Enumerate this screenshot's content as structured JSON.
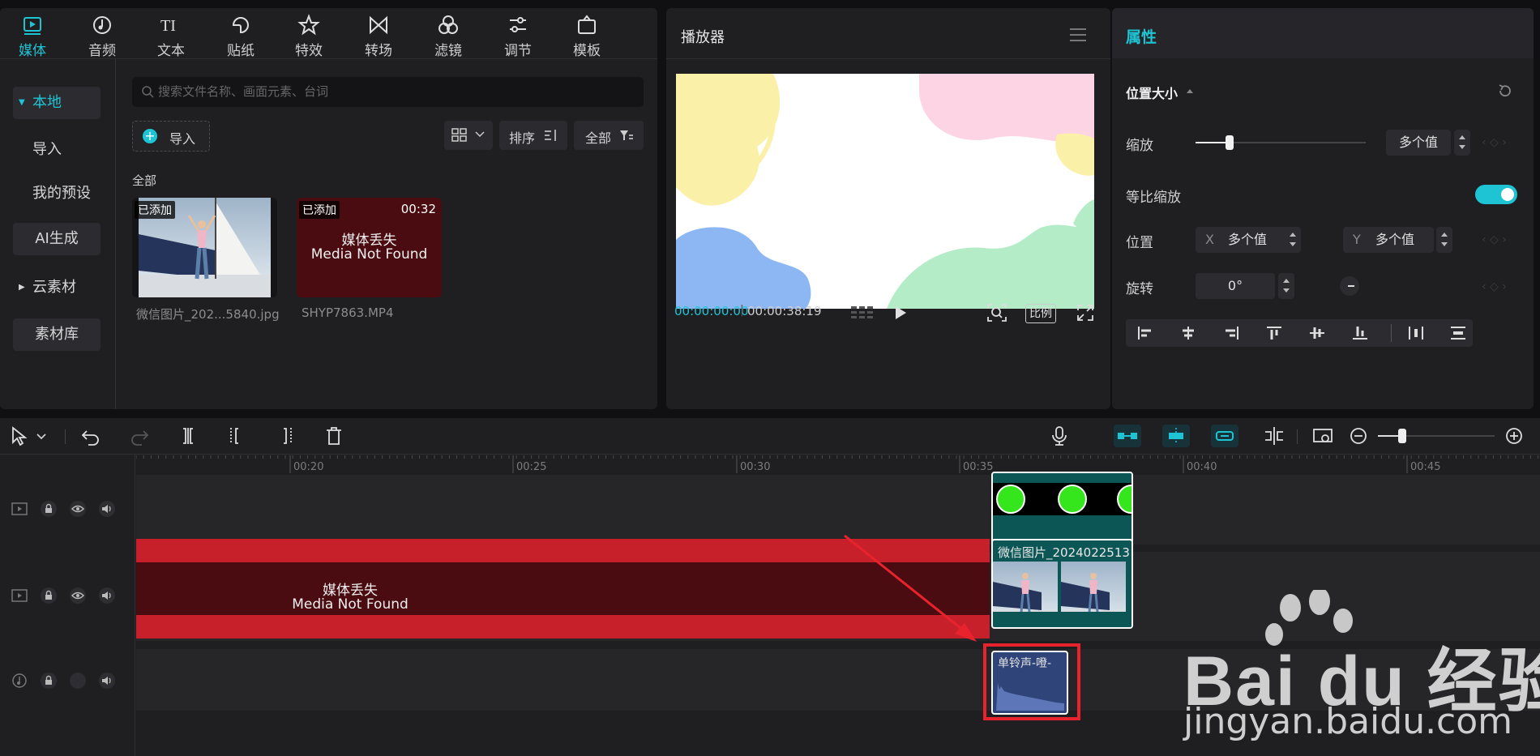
{
  "media_panel": {
    "tabs": [
      {
        "label": "媒体",
        "icon": "media-icon",
        "active": true
      },
      {
        "label": "音频",
        "icon": "music-note-icon"
      },
      {
        "label": "文本",
        "icon": "text-icon"
      },
      {
        "label": "贴纸",
        "icon": "sticker-icon"
      },
      {
        "label": "特效",
        "icon": "sparkle-star-icon"
      },
      {
        "label": "转场",
        "icon": "transition-bowtie-icon"
      },
      {
        "label": "滤镜",
        "icon": "filter-circles-icon"
      },
      {
        "label": "调节",
        "icon": "sliders-icon"
      },
      {
        "label": "模板",
        "icon": "template-icon"
      }
    ],
    "sidebar": [
      {
        "label": "本地",
        "active": true
      },
      {
        "label": "导入"
      },
      {
        "label": "我的预设"
      },
      {
        "label": "AI生成"
      },
      {
        "label": "云素材"
      },
      {
        "label": "素材库"
      }
    ],
    "search_placeholder": "搜索文件名称、画面元素、台词",
    "import_label": "导入",
    "sort_label": "排序",
    "filter_label": "全部",
    "section_label": "全部",
    "items": [
      {
        "tag": "已添加",
        "filename": "微信图片_202...5840.jpg"
      },
      {
        "tag": "已添加",
        "duration": "00:32",
        "missing_cn": "媒体丢失",
        "missing_en": "Media Not Found",
        "filename": "SHYP7863.MP4"
      }
    ]
  },
  "player": {
    "title": "播放器",
    "current_time": "00:00:00:00",
    "total_time": "00:00:38:19",
    "ratio_label": "比例"
  },
  "properties": {
    "title": "属性",
    "section": "位置大小",
    "scale_label": "缩放",
    "scale_value": "多个值",
    "scale_level": 0.2,
    "uniform_scale_label": "等比缩放",
    "uniform_scale_on": true,
    "position_label": "位置",
    "x_label": "X",
    "x_value": "多个值",
    "y_label": "Y",
    "y_value": "多个值",
    "rotation_label": "旋转",
    "rotation_value": "0°",
    "align_icons": [
      "align-left-icon",
      "align-center-h-icon",
      "align-right-icon",
      "align-top-icon",
      "align-center-v-icon",
      "align-bottom-icon",
      "distribute-h-icon",
      "distribute-v-icon"
    ]
  },
  "timeline": {
    "ruler_labels": [
      "00:20",
      "00:25",
      "00:30",
      "00:35",
      "00:40",
      "00:45"
    ],
    "missing_clip_cn": "媒体丢失",
    "missing_clip_en": "Media Not Found",
    "image_clip_title": "微信图片_2024022513",
    "audio_clip_title": "单铃声-噔-"
  },
  "watermark": {
    "brand": "Bai du 经验",
    "url": "jingyan.baidu.com"
  },
  "colors": {
    "accent": "#1fc4d4",
    "missing": "#4a0c10",
    "missing_band": "#c8202a",
    "highlight": "#e8232d"
  }
}
